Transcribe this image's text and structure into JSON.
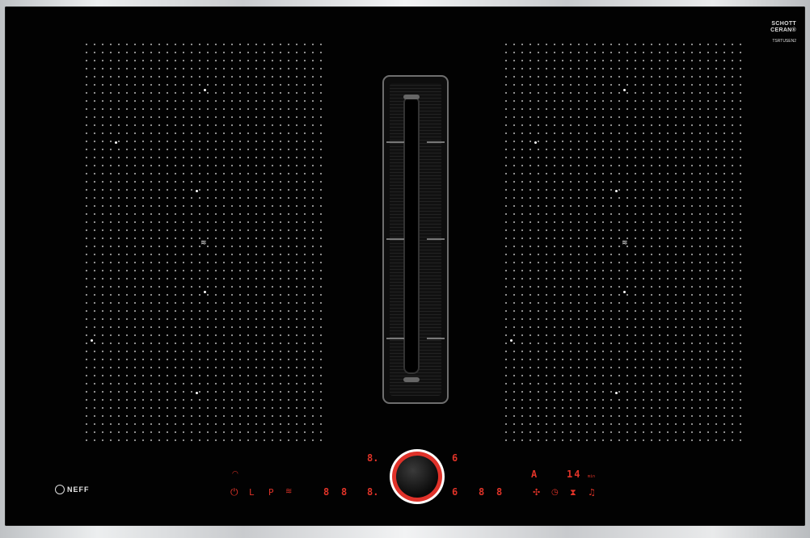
{
  "brand": {
    "logo_text": "NEFF",
    "glass_brand_line1": "SCHOTT",
    "glass_brand_line2": "CERAN®",
    "glass_small_line": "TSRTUSEN2"
  },
  "left_panel": {
    "power_symbol": "⏻",
    "lock_label": "L",
    "powerboost_label": "P",
    "zone_display_1": "8",
    "zone_display_2": "8"
  },
  "center_panel": {
    "left_level_top": "8.",
    "left_level_bottom": "8.",
    "right_level_top": "6",
    "right_level_bottom": "6"
  },
  "right_panel": {
    "zone_display_1": "8",
    "zone_display_2": "8",
    "vent_mode": "A",
    "timer_value": "14",
    "timer_unit": "min"
  },
  "colors": {
    "glass": "#020202",
    "control_red": "#e03328",
    "frame_steel": "#d9dbdd"
  },
  "icons": [
    "wifi-icon",
    "power-icon",
    "fan-zone-icon",
    "hob-zone-icon",
    "fan-icon",
    "clock-icon",
    "timer-icon",
    "bell-icon",
    "cooking-zone-icon"
  ]
}
